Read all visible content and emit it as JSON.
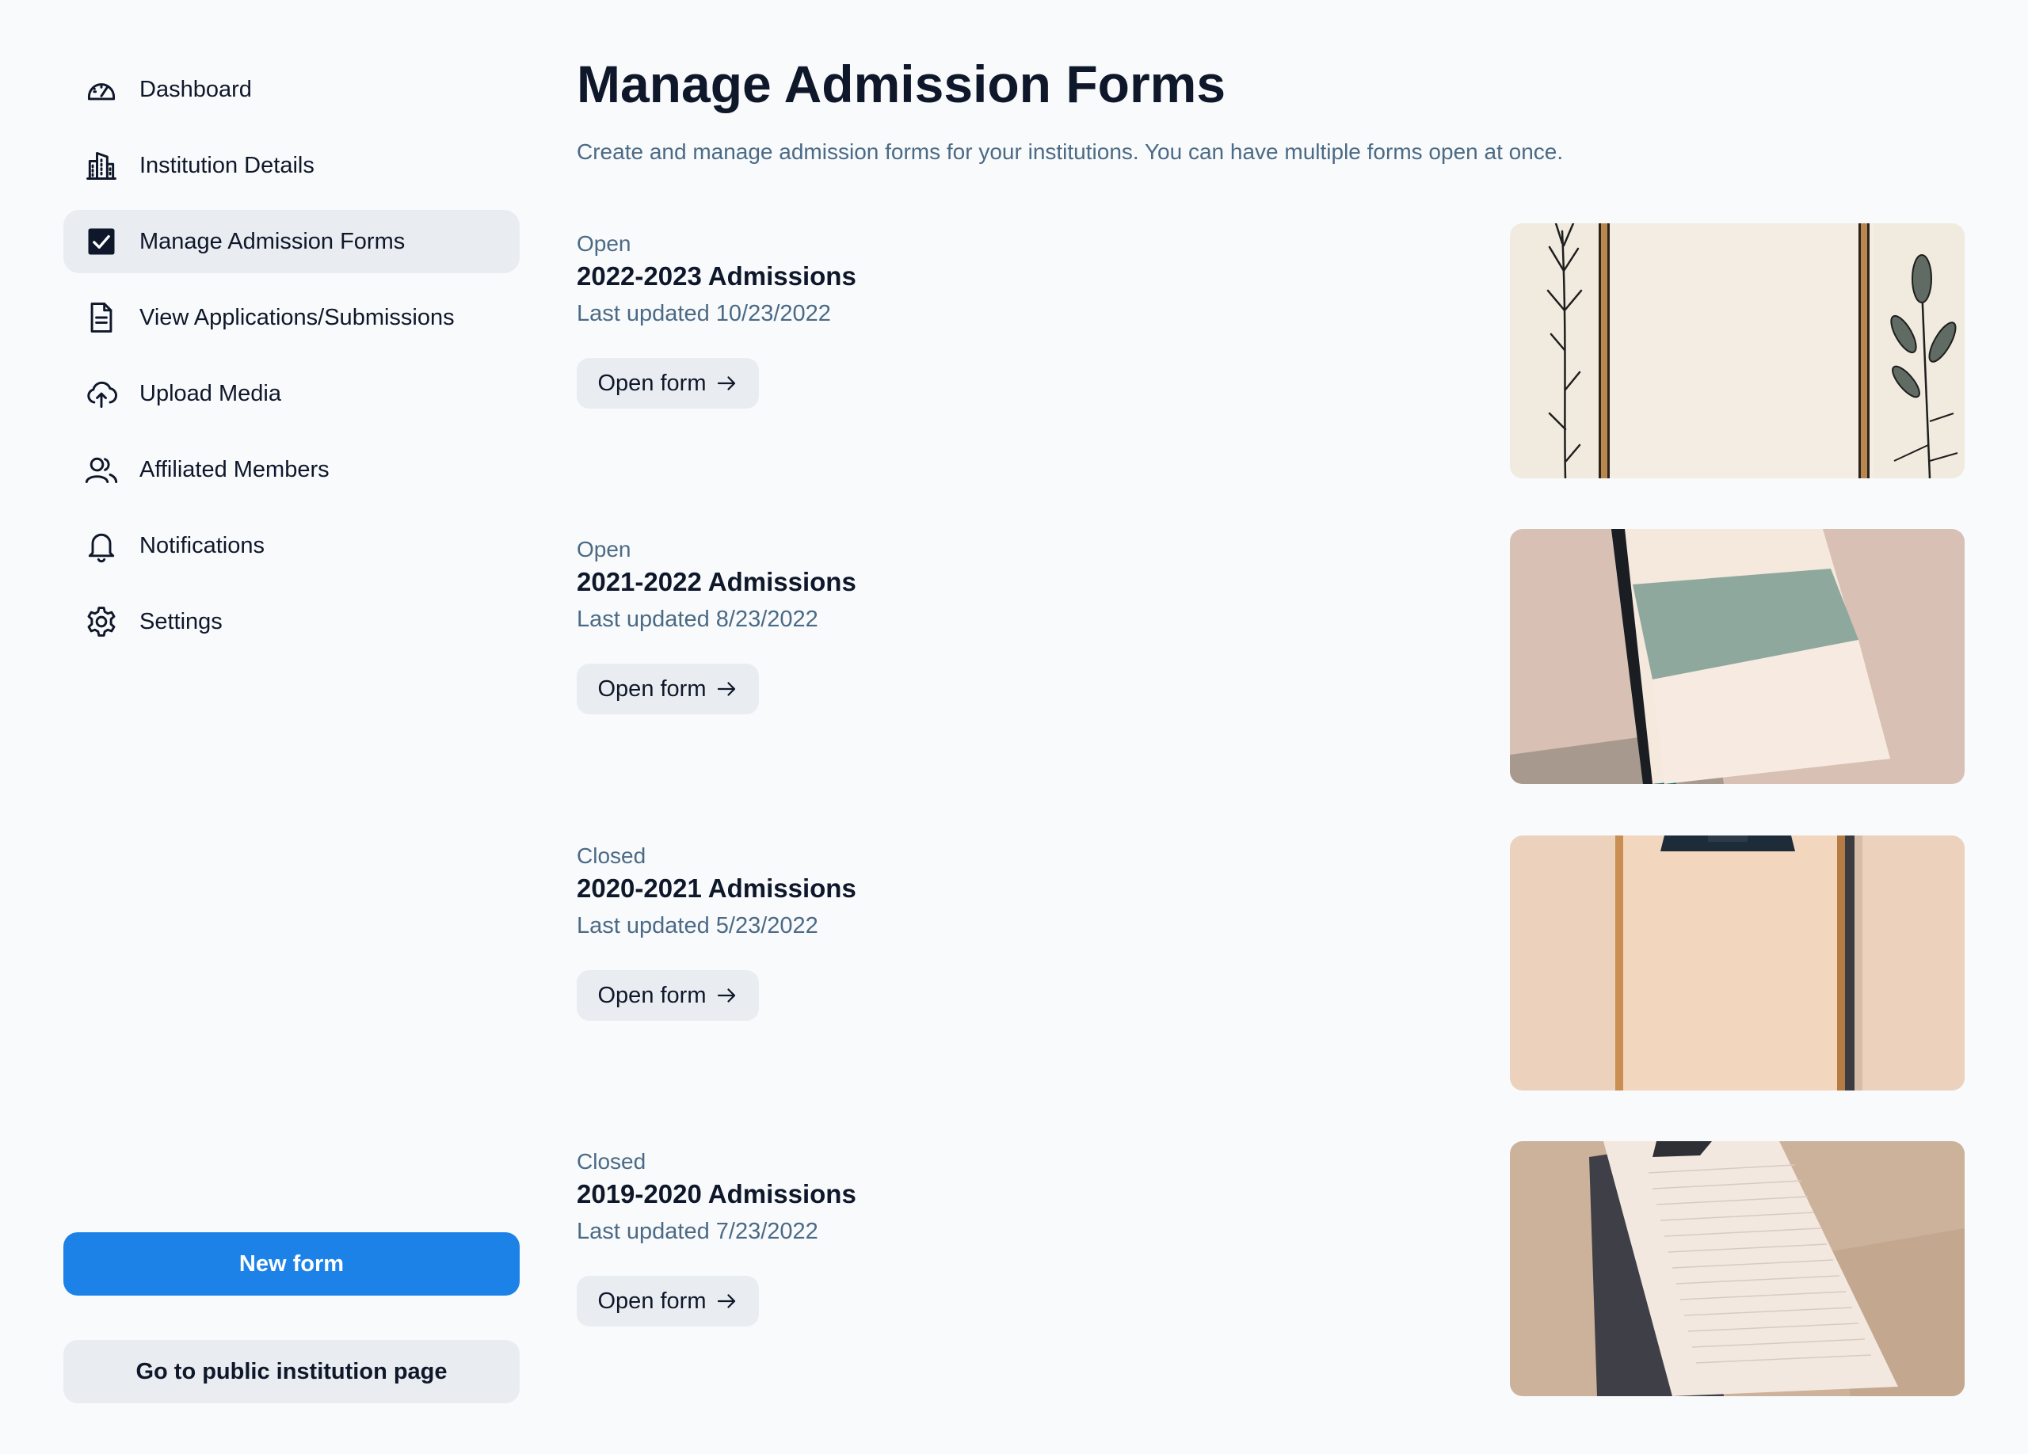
{
  "sidebar": {
    "items": [
      {
        "label": "Dashboard",
        "icon": "gauge-icon"
      },
      {
        "label": "Institution Details",
        "icon": "building-icon"
      },
      {
        "label": "Manage Admission Forms",
        "icon": "checkbox-icon",
        "active": true
      },
      {
        "label": "View Applications/Submissions",
        "icon": "document-icon"
      },
      {
        "label": "Upload Media",
        "icon": "cloud-upload-icon"
      },
      {
        "label": "Affiliated Members",
        "icon": "users-icon"
      },
      {
        "label": "Notifications",
        "icon": "bell-icon"
      },
      {
        "label": "Settings",
        "icon": "gear-icon"
      }
    ],
    "new_form_label": "New form",
    "public_page_label": "Go to public institution page"
  },
  "main": {
    "title": "Manage Admission Forms",
    "subtitle": "Create and manage admission forms for your institutions. You can have multiple forms open at once.",
    "forms": [
      {
        "status": "Open",
        "title": "2022-2023 Admissions",
        "updated": "Last updated 10/23/2022",
        "button": "Open form"
      },
      {
        "status": "Open",
        "title": "2021-2022 Admissions",
        "updated": "Last updated 8/23/2022",
        "button": "Open form"
      },
      {
        "status": "Closed",
        "title": "2020-2021 Admissions",
        "updated": "Last updated 5/23/2022",
        "button": "Open form"
      },
      {
        "status": "Closed",
        "title": "2019-2020 Admissions",
        "updated": "Last updated 7/23/2022",
        "button": "Open form"
      }
    ]
  },
  "colors": {
    "primary": "#1c82e8",
    "muted_text": "#4b6a85",
    "active_bg": "#e9edf1",
    "background": "#f8fafc"
  }
}
